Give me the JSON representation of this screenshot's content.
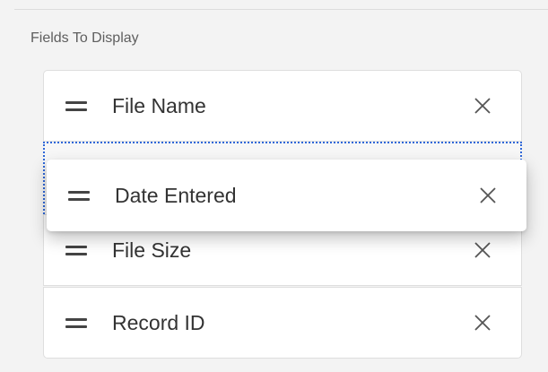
{
  "section": {
    "label": "Fields To Display"
  },
  "fields": [
    {
      "label": "File Name"
    },
    {
      "label": "File Size"
    },
    {
      "label": "Record ID"
    }
  ],
  "dragging": {
    "label": "Date Entered"
  },
  "icons": {
    "drag": "drag-handle-icon",
    "remove": "close-icon"
  },
  "colors": {
    "text": "#333333",
    "muted": "#5e5e5e",
    "drop_target": "#2f67d8",
    "background": "#f3f3f3"
  }
}
